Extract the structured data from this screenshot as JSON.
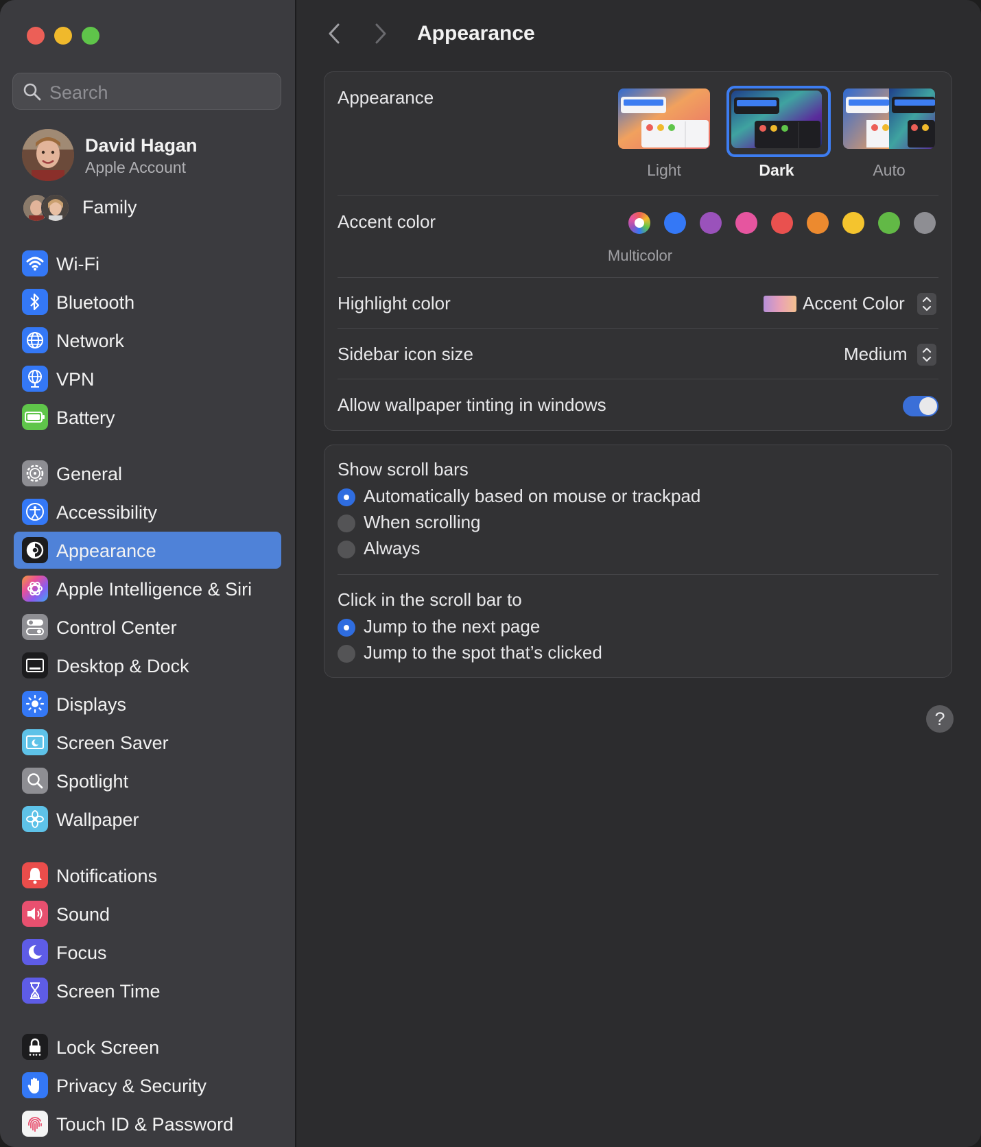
{
  "window": {
    "title": "Appearance",
    "colors": {
      "close": "#ec5f57",
      "minimize": "#f0b92c",
      "zoom": "#5fc54a",
      "accent": "#4f82d8"
    }
  },
  "sidebar": {
    "search_placeholder": "Search",
    "user": {
      "name": "David Hagan",
      "subtitle": "Apple Account"
    },
    "family_label": "Family",
    "items": [
      {
        "label": "Wi-Fi",
        "icon": "wifi-icon"
      },
      {
        "label": "Bluetooth",
        "icon": "bluetooth-icon"
      },
      {
        "label": "Network",
        "icon": "globe-icon"
      },
      {
        "label": "VPN",
        "icon": "vpn-globe-icon"
      },
      {
        "label": "Battery",
        "icon": "battery-icon"
      },
      {
        "label": "General",
        "icon": "gear-icon"
      },
      {
        "label": "Accessibility",
        "icon": "accessibility-icon"
      },
      {
        "label": "Appearance",
        "icon": "appearance-icon",
        "selected": true
      },
      {
        "label": "Apple Intelligence & Siri",
        "icon": "siri-icon"
      },
      {
        "label": "Control Center",
        "icon": "control-center-icon"
      },
      {
        "label": "Desktop & Dock",
        "icon": "dock-icon"
      },
      {
        "label": "Displays",
        "icon": "sun-icon"
      },
      {
        "label": "Screen Saver",
        "icon": "screen-saver-icon"
      },
      {
        "label": "Spotlight",
        "icon": "magnifier-icon"
      },
      {
        "label": "Wallpaper",
        "icon": "flower-icon"
      },
      {
        "label": "Notifications",
        "icon": "bell-icon"
      },
      {
        "label": "Sound",
        "icon": "speaker-icon"
      },
      {
        "label": "Focus",
        "icon": "moon-icon"
      },
      {
        "label": "Screen Time",
        "icon": "hourglass-icon"
      },
      {
        "label": "Lock Screen",
        "icon": "lock-icon"
      },
      {
        "label": "Privacy & Security",
        "icon": "hand-icon"
      },
      {
        "label": "Touch ID & Password",
        "icon": "fingerprint-icon"
      }
    ]
  },
  "main": {
    "appearance_card": {
      "appearance_label": "Appearance",
      "modes": [
        {
          "label": "Light",
          "selected": false
        },
        {
          "label": "Dark",
          "selected": true
        },
        {
          "label": "Auto",
          "selected": false
        }
      ],
      "accent_label": "Accent color",
      "accent_selected_name": "Multicolor",
      "accent_colors": [
        "multicolor",
        "#3478f6",
        "#9a52bb",
        "#e6559f",
        "#e9514f",
        "#ec8a2f",
        "#f4c42e",
        "#62b946",
        "#8e8e93"
      ],
      "highlight_label": "Highlight color",
      "highlight_value": "Accent Color",
      "sidebar_icon_label": "Sidebar icon size",
      "sidebar_icon_value": "Medium",
      "tinting_label": "Allow wallpaper tinting in windows",
      "tinting_on": true
    },
    "scroll_card": {
      "show_label": "Show scroll bars",
      "show_options": [
        {
          "label": "Automatically based on mouse or trackpad",
          "selected": true
        },
        {
          "label": "When scrolling",
          "selected": false
        },
        {
          "label": "Always",
          "selected": false
        }
      ],
      "click_label": "Click in the scroll bar to",
      "click_options": [
        {
          "label": "Jump to the next page",
          "selected": true
        },
        {
          "label": "Jump to the spot that’s clicked",
          "selected": false
        }
      ]
    },
    "help": "?"
  }
}
